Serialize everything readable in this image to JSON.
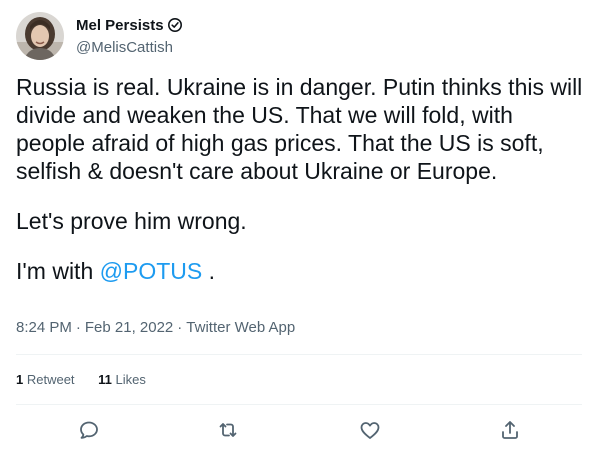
{
  "author": {
    "display_name": "Mel Persists",
    "handle": "@MelisCattish",
    "verified_icon": "verified-badge-icon",
    "avatar": "user-avatar-photo"
  },
  "tweet": {
    "paragraph_1": "Russia is real. Ukraine is in danger. Putin thinks this will divide and weaken the US. That we will fold, with people afraid of high gas prices. That the US is soft, selfish & doesn't care about Ukraine or Europe.",
    "paragraph_2": "Let's prove him wrong.",
    "paragraph_3_prefix": "I'm with ",
    "paragraph_3_mention": "@POTUS",
    "paragraph_3_suffix": " ."
  },
  "meta": {
    "time": "8:24 PM",
    "separator": "·",
    "date": "Feb 21, 2022",
    "source": "Twitter Web App"
  },
  "stats": {
    "retweets_count": "1",
    "retweets_label": " Retweet",
    "likes_count": "11",
    "likes_label": " Likes"
  },
  "actions": {
    "reply_icon": "reply-icon",
    "retweet_icon": "retweet-icon",
    "like_icon": "heart-icon",
    "share_icon": "share-icon"
  },
  "colors": {
    "text": "#0f1419",
    "secondary": "#536471",
    "accent": "#1d9bf0",
    "divider": "#eff3f4"
  }
}
